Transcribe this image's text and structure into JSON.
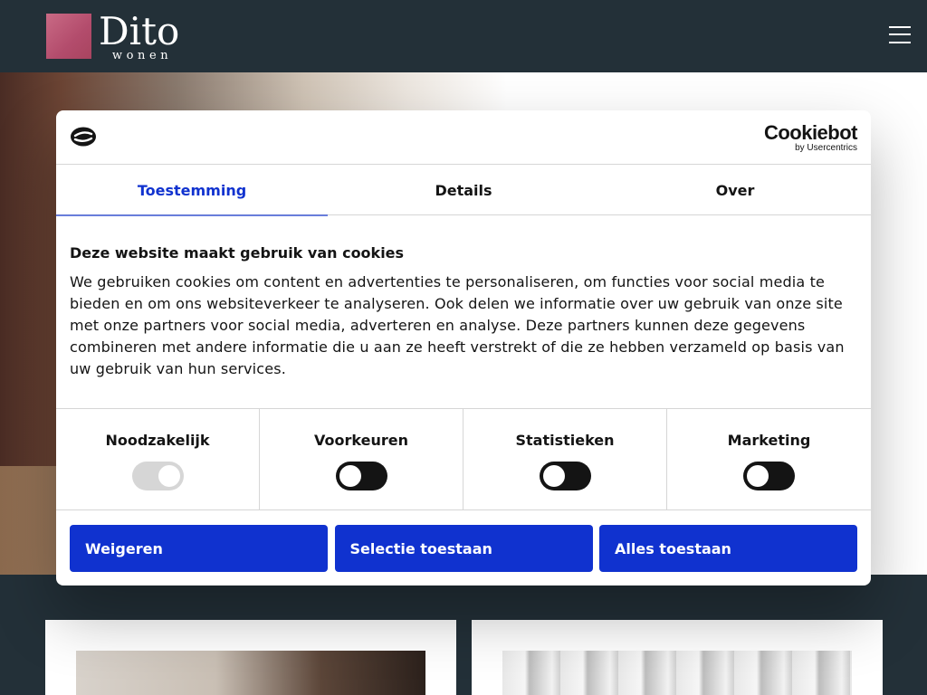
{
  "header": {
    "logo_main": "Dito",
    "logo_sub": "wonen",
    "logo_color": "#b34c6c",
    "menu_icon": "hamburger-icon"
  },
  "dialog": {
    "brand_main": "Cookiebot",
    "brand_sub": "by Usercentrics",
    "brand_icon": "cookiebot-icon",
    "tabs": [
      {
        "label": "Toestemming",
        "active": true
      },
      {
        "label": "Details",
        "active": false
      },
      {
        "label": "Over",
        "active": false
      }
    ],
    "title": "Deze website maakt gebruik van cookies",
    "body": "We gebruiken cookies om content en advertenties te personaliseren, om functies voor social media te bieden en om ons websiteverkeer te analyseren. Ook delen we informatie over uw gebruik van onze site met onze partners voor social media, adverteren en analyse. Deze partners kunnen deze gegevens combineren met andere informatie die u aan ze heeft verstrekt of die ze hebben verzameld op basis van uw gebruik van hun services.",
    "preferences": [
      {
        "label": "Noodzakelijk",
        "enabled": true,
        "locked": true
      },
      {
        "label": "Voorkeuren",
        "enabled": false,
        "locked": false
      },
      {
        "label": "Statistieken",
        "enabled": false,
        "locked": false
      },
      {
        "label": "Marketing",
        "enabled": false,
        "locked": false
      }
    ],
    "buttons": {
      "deny": "Weigeren",
      "allow_selection": "Selectie toestaan",
      "allow_all": "Alles toestaan"
    },
    "accent_color": "#1032cf"
  }
}
